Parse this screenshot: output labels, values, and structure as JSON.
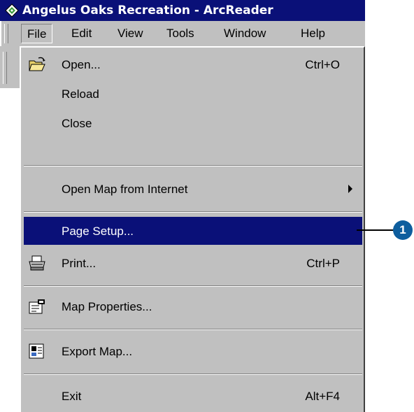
{
  "window": {
    "title": "Angelus Oaks Recreation - ArcReader"
  },
  "menubar": {
    "items": [
      {
        "label": "File"
      },
      {
        "label": "Edit"
      },
      {
        "label": "View"
      },
      {
        "label": "Tools"
      },
      {
        "label": "Window"
      },
      {
        "label": "Help"
      }
    ]
  },
  "file_menu": {
    "open": {
      "label": "Open...",
      "shortcut": "Ctrl+O",
      "icon": "open-folder-icon"
    },
    "reload": {
      "label": "Reload"
    },
    "close": {
      "label": "Close"
    },
    "open_map_internet": {
      "label": "Open Map from Internet",
      "icon": "submenu-arrow-icon"
    },
    "page_setup": {
      "label": "Page Setup..."
    },
    "print": {
      "label": "Print...",
      "shortcut": "Ctrl+P",
      "icon": "printer-icon"
    },
    "map_properties": {
      "label": "Map Properties...",
      "icon": "map-properties-icon"
    },
    "export_map": {
      "label": "Export Map...",
      "icon": "export-map-icon"
    },
    "exit": {
      "label": "Exit",
      "shortcut": "Alt+F4"
    }
  },
  "callout": {
    "number": "1"
  },
  "colors": {
    "highlight": "#0a1078",
    "menu_bg": "#c0c0c0",
    "callout": "#0e5e9e"
  }
}
